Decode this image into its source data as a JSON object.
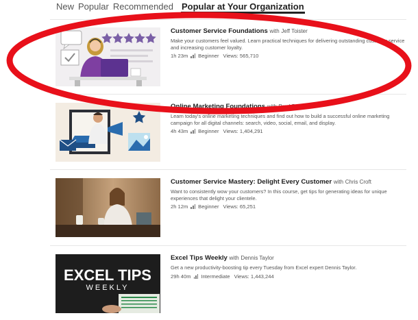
{
  "tabs": [
    {
      "label": "New"
    },
    {
      "label": "Popular"
    },
    {
      "label": "Recommended"
    },
    {
      "label": "Popular at Your Organization",
      "active": true
    }
  ],
  "author_prefix": "with",
  "courses": [
    {
      "title": "Customer Service Foundations",
      "author": "Jeff Toister",
      "description": "Make your customers feel valued. Learn practical techniques for delivering outstanding customer service and increasing customer loyalty.",
      "duration": "1h 23m",
      "level": "Beginner",
      "views": "Views: 565,710"
    },
    {
      "title": "Online Marketing Foundations",
      "author": "Brad Batesole",
      "description": "Learn today's online marketing techniques and find out how to build a successful online marketing campaign for all digital channels: search, video, social, email, and display.",
      "duration": "4h 43m",
      "level": "Beginner",
      "views": "Views: 1,404,291"
    },
    {
      "title": "Customer Service Mastery: Delight Every Customer",
      "author": "Chris Croft",
      "description": "Want to consistently wow your customers? In this course, get tips for generating ideas for unique experiences that delight your clientele.",
      "duration": "2h 12m",
      "level": "Beginner",
      "views": "Views: 65,251"
    },
    {
      "title": "Excel Tips Weekly",
      "author": "Dennis Taylor",
      "description": "Get a new productivity-boosting tip every Tuesday from Excel expert Dennis Taylor.",
      "duration": "29h 40m",
      "level": "Intermediate",
      "views": "Views: 1,443,244",
      "thumb_title": "EXCEL TIPS",
      "thumb_subtitle": "WEEKLY"
    }
  ],
  "colors": {
    "annotation_red": "#e8101a",
    "star_purple": "#7a5fa6",
    "marketing_navy": "#1f4f86"
  }
}
